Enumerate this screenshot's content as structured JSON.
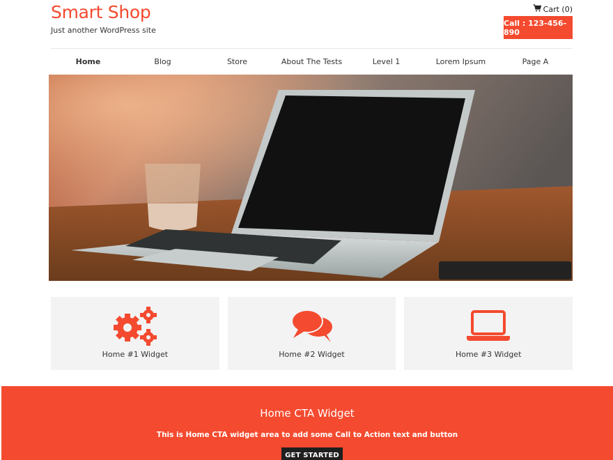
{
  "header": {
    "site_title": "Smart Shop",
    "tagline": "Just another WordPress site",
    "cart_label": "Cart (0)",
    "call_label": "Call : 123-456-890"
  },
  "nav": {
    "items": [
      "Home",
      "Blog",
      "Store",
      "About The Tests",
      "Level 1",
      "Lorem Ipsum",
      "Page A"
    ],
    "active": "Home"
  },
  "hero": {
    "icon": "laptop-on-table-photo"
  },
  "widgets": [
    {
      "title": "Home #1 Widget",
      "icon": "gears-icon"
    },
    {
      "title": "Home #2 Widget",
      "icon": "comments-icon"
    },
    {
      "title": "Home #3 Widget",
      "icon": "laptop-icon"
    }
  ],
  "cta": {
    "title": "Home CTA Widget",
    "text": "This is Home CTA widget area to add some Call to Action text and button",
    "button_label": "GET STARTED"
  },
  "colors": {
    "accent": "#f44a2f",
    "widget_bg": "#f3f3f3",
    "button_dark": "#1f1f1f"
  }
}
